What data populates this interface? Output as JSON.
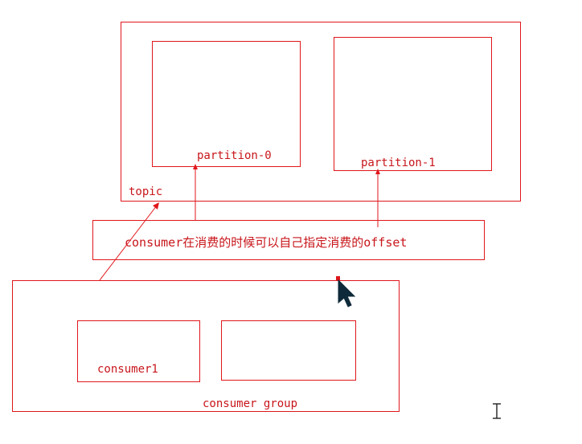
{
  "diagram": {
    "topic_label": "topic",
    "partitions": [
      {
        "label": "partition-0"
      },
      {
        "label": "partition-1"
      }
    ],
    "note": "consumer在消费的时候可以自己指定消费的offset",
    "group_label": "consumer group",
    "consumers": [
      {
        "label": "consumer1"
      },
      {
        "label": ""
      }
    ]
  },
  "colors": {
    "line": "#e0161b",
    "text": "#c8161b",
    "cursor": "#0e2a3a"
  },
  "icons": {
    "pointer": "arrow-cursor-icon",
    "text_cursor": "ibeam-cursor-icon"
  }
}
